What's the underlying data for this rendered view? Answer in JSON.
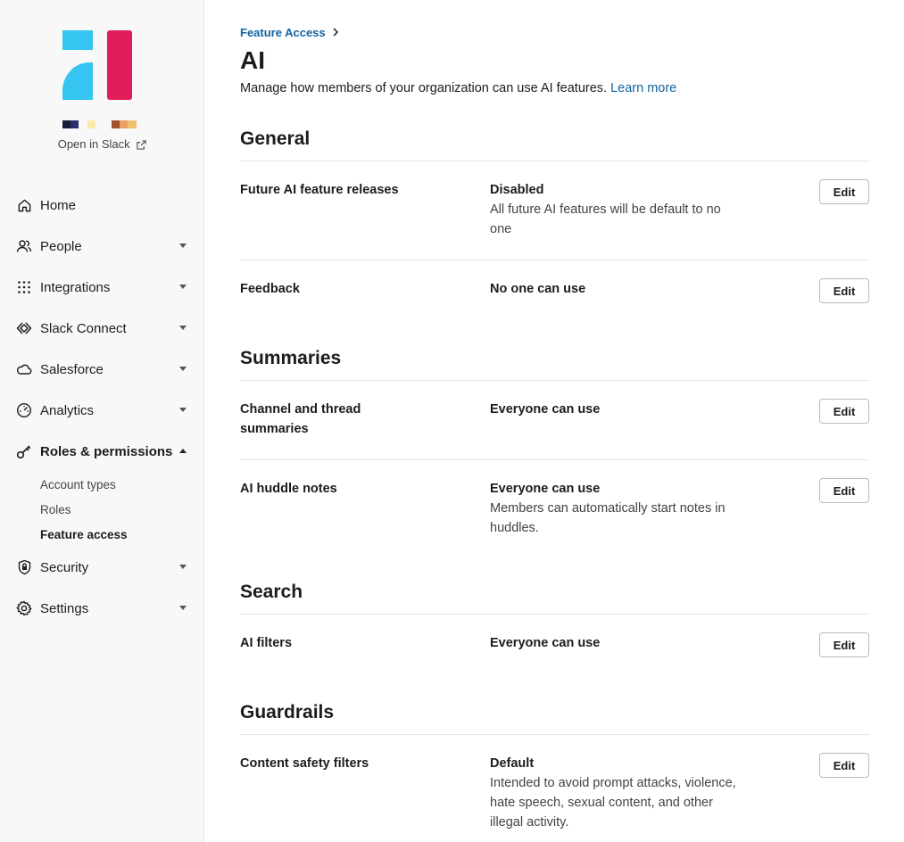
{
  "brand": {
    "colors": {
      "logo_blue": "#36c5f0",
      "logo_red": "#e01e5a",
      "link": "#1264a3"
    },
    "org_strip_colors": [
      "#1a1a3a",
      "#2d2d6b",
      "#f8f8f8",
      "#fbe9a8",
      "#f8f8f8",
      "#a0522d",
      "#e8a060",
      "#f0c070"
    ],
    "open_in_slack": "Open in Slack"
  },
  "sidebar": {
    "items": [
      {
        "label": "Home",
        "icon": "home-icon",
        "has_caret": false
      },
      {
        "label": "People",
        "icon": "people-icon",
        "has_caret": true
      },
      {
        "label": "Integrations",
        "icon": "grid-dots-icon",
        "has_caret": true
      },
      {
        "label": "Slack Connect",
        "icon": "slack-connect-icon",
        "has_caret": true
      },
      {
        "label": "Salesforce",
        "icon": "cloud-icon",
        "has_caret": true
      },
      {
        "label": "Analytics",
        "icon": "gauge-icon",
        "has_caret": true
      },
      {
        "label": "Roles & permissions",
        "icon": "key-icon",
        "has_caret": true,
        "expanded": true
      },
      {
        "label": "Security",
        "icon": "shield-lock-icon",
        "has_caret": true
      },
      {
        "label": "Settings",
        "icon": "gear-icon",
        "has_caret": true
      }
    ],
    "roles_subitems": [
      "Account types",
      "Roles",
      "Feature access"
    ],
    "current_subitem": "Feature access"
  },
  "header": {
    "breadcrumb": "Feature Access",
    "title": "AI",
    "description": "Manage how members of your organization can use AI features.",
    "learn_more": "Learn more"
  },
  "sections": [
    {
      "title": "General",
      "rows": [
        {
          "label": "Future AI feature releases",
          "status": "Disabled",
          "detail": "All future AI features will be default to no one",
          "button": "Edit"
        },
        {
          "label": "Feedback",
          "status": "No one can use",
          "detail": "",
          "button": "Edit"
        }
      ]
    },
    {
      "title": "Summaries",
      "rows": [
        {
          "label": "Channel and thread summaries",
          "status": "Everyone can use",
          "detail": "",
          "button": "Edit"
        },
        {
          "label": "AI huddle notes",
          "status": "Everyone can use",
          "detail": "Members can automatically start notes in huddles.",
          "button": "Edit"
        }
      ]
    },
    {
      "title": "Search",
      "rows": [
        {
          "label": "AI filters",
          "status": "Everyone can use",
          "detail": "",
          "button": "Edit"
        }
      ]
    },
    {
      "title": "Guardrails",
      "rows": [
        {
          "label": "Content safety filters",
          "status": "Default",
          "detail": "Intended to avoid prompt attacks, violence, hate speech, sexual content, and other illegal activity.",
          "button": "Edit"
        }
      ]
    }
  ]
}
